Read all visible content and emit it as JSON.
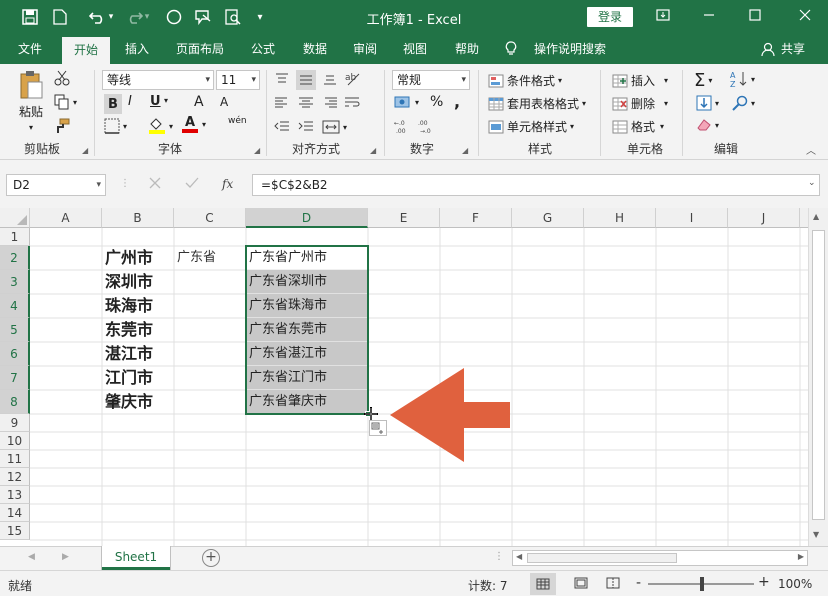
{
  "titlebar": {
    "title": "工作簿1  -  Excel",
    "login": "登录",
    "qat": {
      "dropdown": "▾"
    }
  },
  "tabs": [
    "文件",
    "开始",
    "插入",
    "页面布局",
    "公式",
    "数据",
    "审阅",
    "视图",
    "帮助",
    "操作说明搜索",
    "共享"
  ],
  "ribbon": {
    "clipboard": {
      "paste": "粘贴",
      "label": "剪贴板"
    },
    "font": {
      "name": "等线",
      "size": "11",
      "bold": "B",
      "italic": "I",
      "underline": "U",
      "grow": "A",
      "shrink": "A",
      "font_color": "A",
      "phonetic": "wén",
      "label": "字体"
    },
    "alignment": {
      "label": "对齐方式"
    },
    "number": {
      "format": "常规",
      "percent": "%",
      "comma": ",",
      "inc": ".00→.0",
      "label": "数字"
    },
    "styles": {
      "conditional": "条件格式",
      "table": "套用表格格式",
      "cell": "单元格样式",
      "label": "样式"
    },
    "cells": {
      "insert": "插入",
      "delete": "删除",
      "format": "格式",
      "label": "单元格"
    },
    "editing": {
      "label": "编辑"
    }
  },
  "formula_bar": {
    "name_box": "D2",
    "fx": "fx",
    "formula": "=$C$2&B2"
  },
  "grid": {
    "columns": [
      "A",
      "B",
      "C",
      "D",
      "E",
      "F",
      "G",
      "H",
      "I",
      "J"
    ],
    "rows": [
      "1",
      "2",
      "3",
      "4",
      "5",
      "6",
      "7",
      "8",
      "9",
      "10",
      "11",
      "12",
      "13",
      "14",
      "15"
    ],
    "colB": [
      "广州市",
      "深圳市",
      "珠海市",
      "东莞市",
      "湛江市",
      "江门市",
      "肇庆市"
    ],
    "c2": "广东省",
    "colD": [
      "广东省广州市",
      "广东省深圳市",
      "广东省珠海市",
      "广东省东莞市",
      "广东省湛江市",
      "广东省江门市",
      "广东省肇庆市"
    ]
  },
  "sheet": {
    "tab": "Sheet1",
    "add": "+"
  },
  "status": {
    "ready": "就绪",
    "count": "计数: 7",
    "zoom": "100%",
    "minus": "-",
    "plus": "+"
  },
  "colors": {
    "accent": "#217346",
    "arrow": "#E0613E"
  }
}
